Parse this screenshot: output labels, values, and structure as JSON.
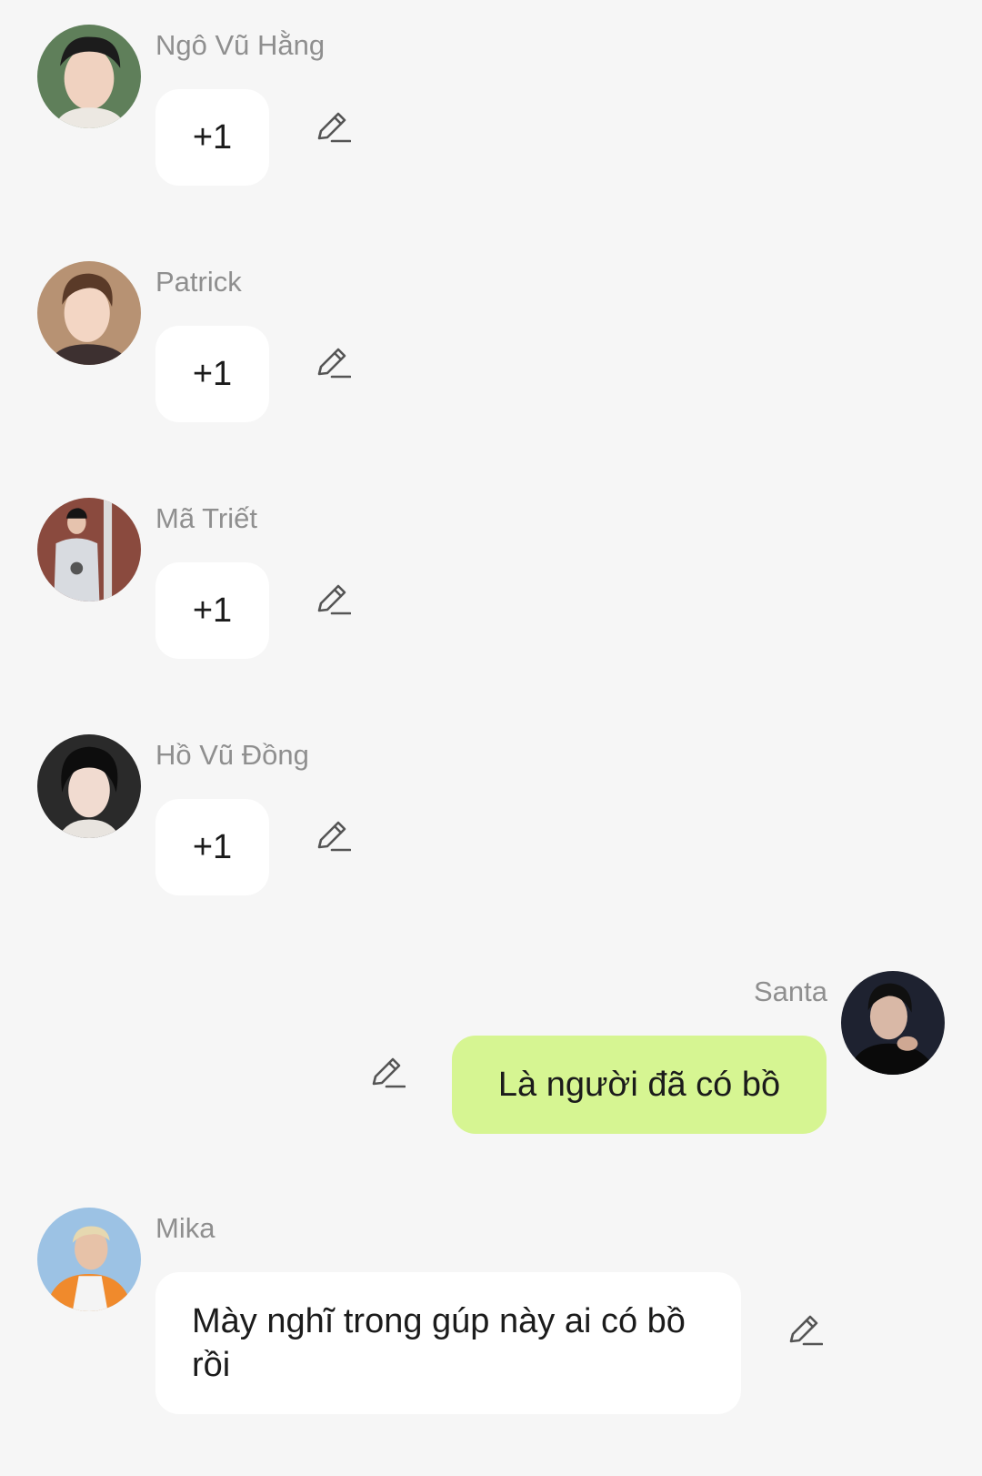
{
  "messages": [
    {
      "sender": "Ngô Vũ Hằng",
      "text": "+1"
    },
    {
      "sender": "Patrick",
      "text": "+1"
    },
    {
      "sender": "Mã Triết",
      "text": "+1"
    },
    {
      "sender": "Hồ Vũ Đồng",
      "text": "+1"
    },
    {
      "sender": "Santa",
      "text": "Là người đã có bồ"
    },
    {
      "sender": "Mika",
      "text": "Mày nghĩ trong gúp này ai có bồ rồi"
    }
  ],
  "colors": {
    "background": "#f6f6f6",
    "incoming_bubble": "#ffffff",
    "outgoing_bubble": "#d6f592",
    "sender_name": "#8f8f8f",
    "message_text": "#1b1b1b",
    "icon": "#555555"
  },
  "icons": {
    "edit": "pencil-icon"
  }
}
